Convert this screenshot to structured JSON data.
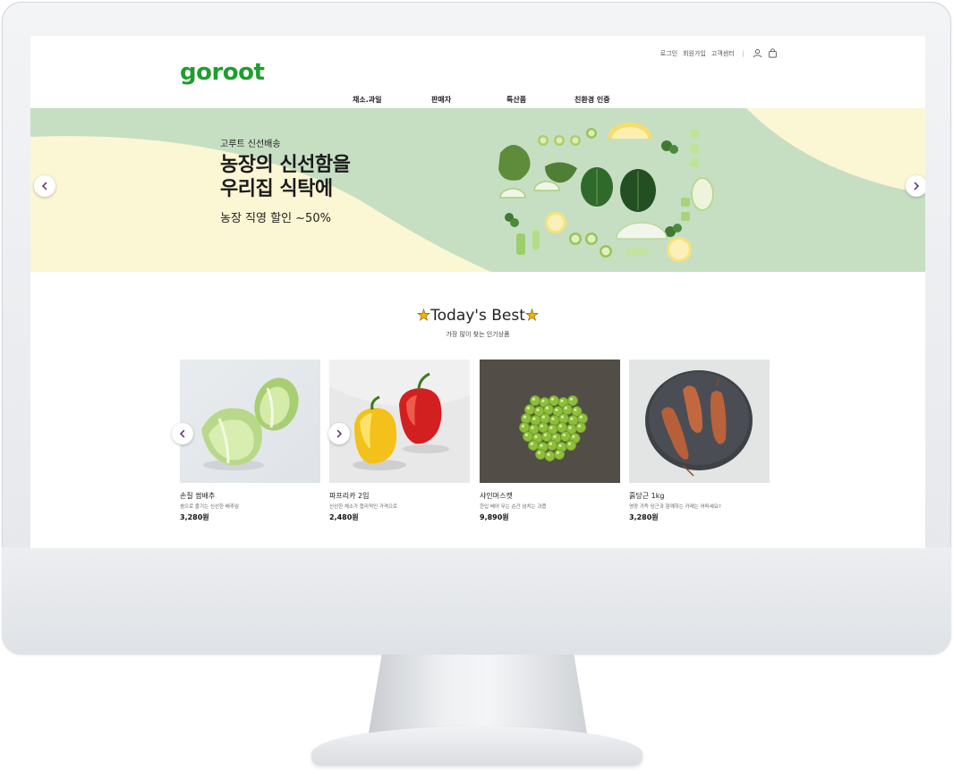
{
  "site": {
    "logo": "goroot",
    "brand_color": "#1f9e2d"
  },
  "util_nav": {
    "login": "로그인",
    "signup": "회원가입",
    "support": "고객센터",
    "divider": "|",
    "icons": [
      "user-icon",
      "shopping-bag-icon"
    ]
  },
  "gnb": {
    "items": [
      "채소.과일",
      "판매자",
      "특산품",
      "친환경 인증"
    ]
  },
  "banner": {
    "subtitle": "고루트 신선배송",
    "title_line1": "농장의 신선함을",
    "title_line2": "우리집 식탁에",
    "desc": "농장 직영 할인 ~50%",
    "colors": {
      "green": "#c6dfc3",
      "cream": "#fbf6d3"
    },
    "prev_icon": "chevron-left-icon",
    "next_icon": "chevron-right-icon"
  },
  "best": {
    "star_left": "★",
    "title": "Today's Best",
    "star_right": "★",
    "subtitle": "가장 많이 찾는 인기상품",
    "products": [
      {
        "name": "손질 쌈배추",
        "desc": "쌈으로 즐기는 신선한 배추잎",
        "price": "3,280원"
      },
      {
        "name": "파프리카 2입",
        "desc": "신선한 채소가 합리적인 가격으로",
        "price": "2,480원"
      },
      {
        "name": "샤인머스캣",
        "desc": "한입 베어 무는 순간 넘치는 과즙",
        "price": "9,890원"
      },
      {
        "name": "흙당근 1kg",
        "desc": "영양 가득 당근과 함께하는 카레는 어떠세요?",
        "price": "3,280원"
      }
    ]
  }
}
